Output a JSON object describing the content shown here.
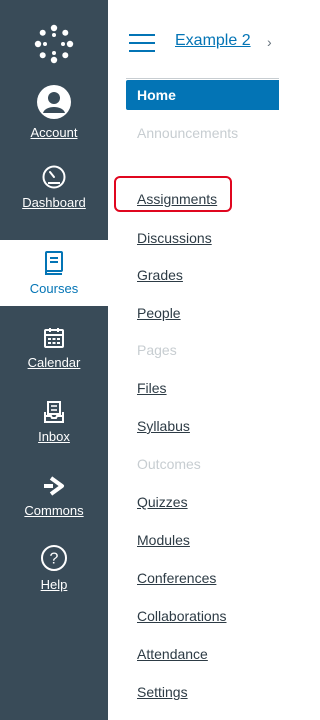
{
  "global_nav": {
    "logo_icon": "canvas-logo-icon",
    "items": [
      {
        "label": "Account",
        "icon": "account-icon"
      },
      {
        "label": "Dashboard",
        "icon": "dashboard-icon"
      },
      {
        "label": "Courses",
        "icon": "courses-icon",
        "active": true
      },
      {
        "label": "Calendar",
        "icon": "calendar-icon"
      },
      {
        "label": "Inbox",
        "icon": "inbox-icon"
      },
      {
        "label": "Commons",
        "icon": "commons-icon"
      },
      {
        "label": "Help",
        "icon": "help-icon"
      }
    ]
  },
  "header": {
    "menu_icon": "hamburger-icon",
    "breadcrumb": "Example 2",
    "breadcrumb_separator": "›"
  },
  "course_nav": {
    "items": [
      {
        "label": "Home",
        "active": true
      },
      {
        "label": "Announcements",
        "disabled": true
      },
      {
        "label": "Assignments",
        "highlighted": true
      },
      {
        "label": "Discussions"
      },
      {
        "label": "Grades"
      },
      {
        "label": "People"
      },
      {
        "label": "Pages",
        "disabled": true
      },
      {
        "label": "Files"
      },
      {
        "label": "Syllabus"
      },
      {
        "label": "Outcomes",
        "disabled": true
      },
      {
        "label": "Quizzes"
      },
      {
        "label": "Modules"
      },
      {
        "label": "Conferences"
      },
      {
        "label": "Collaborations"
      },
      {
        "label": "Attendance"
      },
      {
        "label": "Settings"
      }
    ]
  },
  "colors": {
    "nav_bg": "#394B58",
    "brand_blue": "#0374B5",
    "highlight_red": "#E0061F",
    "disabled_text": "#C7CDD1"
  }
}
